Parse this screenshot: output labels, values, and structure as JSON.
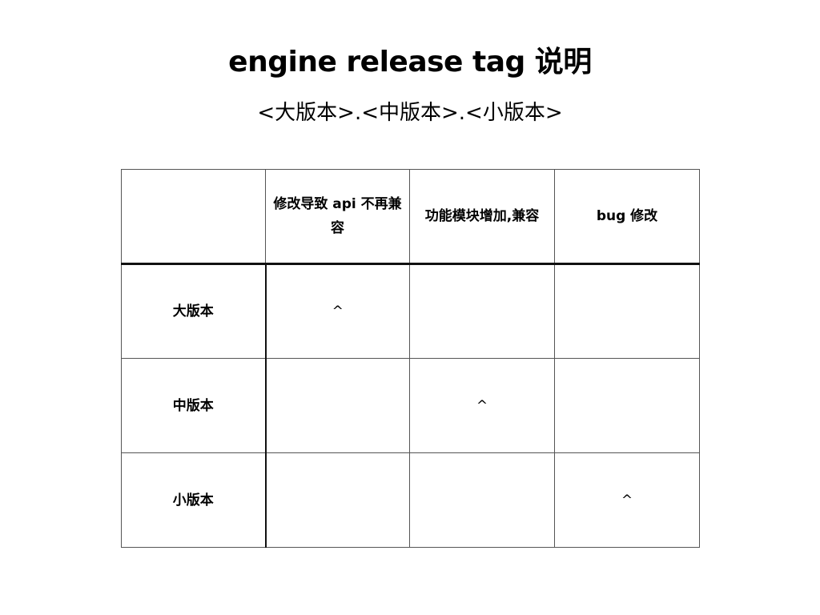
{
  "title": "engine release tag 说明",
  "subtitle": "<大版本>.<中版本>.<小版本>",
  "table": {
    "headers": [
      "",
      "修改导致 api 不再兼容",
      "功能模块增加,兼容",
      "bug 修改"
    ],
    "rows": [
      {
        "label": "大版本",
        "cells": [
          "^",
          "",
          ""
        ]
      },
      {
        "label": "中版本",
        "cells": [
          "",
          "^",
          ""
        ]
      },
      {
        "label": "小版本",
        "cells": [
          "",
          "",
          "^"
        ]
      }
    ]
  }
}
